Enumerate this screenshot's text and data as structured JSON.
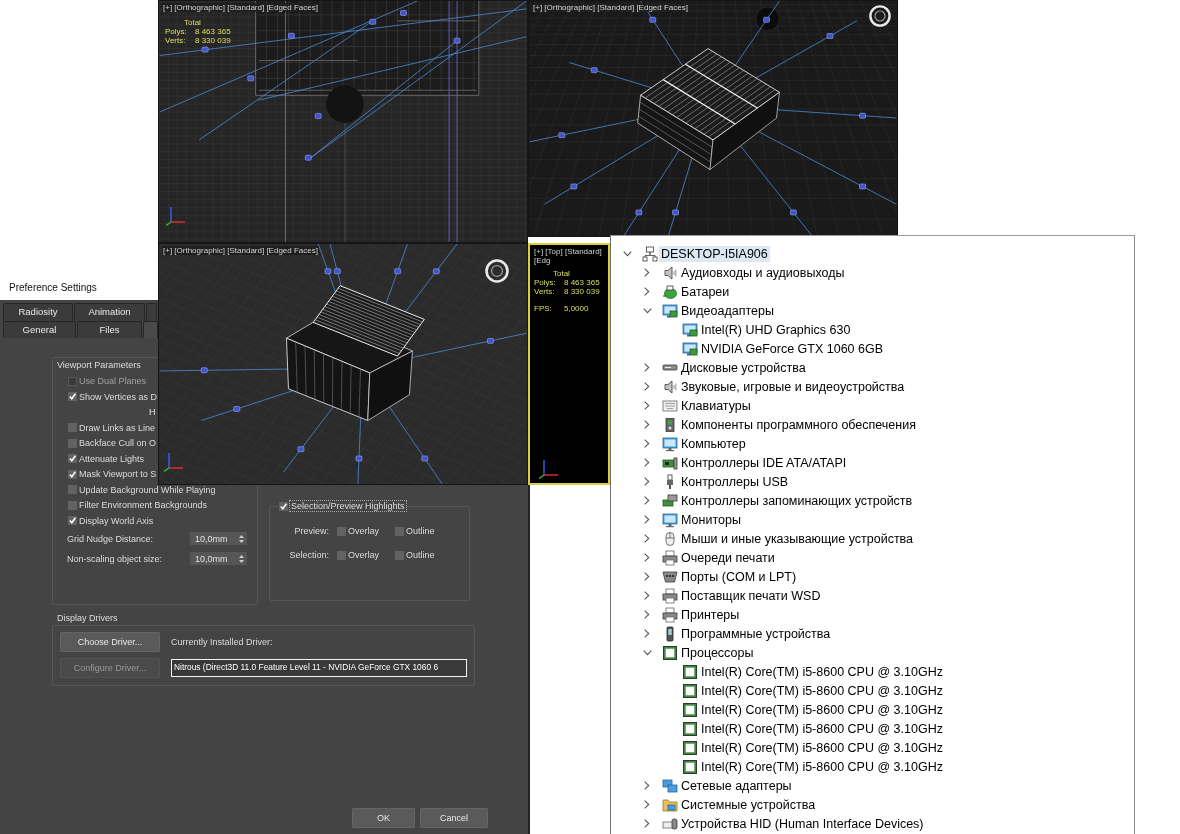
{
  "viewports": [
    {
      "kind": "interior",
      "label": "[+] [Orthographic] [Standard] [Edged Faces]",
      "active": false,
      "stats": {
        "heading": "Total",
        "rows": [
          {
            "name": "Polys:",
            "value": "8 463 365"
          },
          {
            "name": "Verts:",
            "value": "8 330 039"
          }
        ]
      }
    },
    {
      "kind": "perspective",
      "label": "[+] [Orthographic] [Standard] [Edged Faces]",
      "active": false
    },
    {
      "kind": "iso",
      "label": "[+] [Orthographic] [Standard] [Edged Faces]",
      "active": false
    },
    {
      "kind": "top",
      "label": "[+] [Top] [Standard] [Edg",
      "active": true,
      "stats": {
        "heading": "Total",
        "rows": [
          {
            "name": "Polys:",
            "value": "8 463 365"
          },
          {
            "name": "Verts:",
            "value": "8 330 039"
          }
        ],
        "fps": {
          "name": "FPS:",
          "value": "5,0000"
        }
      }
    }
  ],
  "preferences": {
    "title": "Preference Settings",
    "tab_rows": [
      [
        {
          "label": "Radiosity",
          "selected": false
        },
        {
          "label": "Animation",
          "selected": false
        },
        {
          "selected": false
        }
      ],
      [
        {
          "label": "General",
          "selected": false
        },
        {
          "label": "Files",
          "selected": false
        },
        {
          "selected": true
        }
      ]
    ],
    "viewport_parameters": {
      "title": "Viewport Parameters",
      "options": [
        {
          "kind": "check",
          "label": "Use Dual Planes",
          "checked": false,
          "disabled": true
        },
        {
          "kind": "check",
          "label": "Show Vertices as D",
          "checked": true,
          "disabled": false
        },
        {
          "kind": "text",
          "label": "H"
        },
        {
          "kind": "check",
          "label": "Draw Links as Line",
          "checked": false,
          "disabled": false
        },
        {
          "kind": "check",
          "label": "Backface Cull on O",
          "checked": false,
          "disabled": false
        },
        {
          "kind": "check",
          "label": "Attenuate Lights",
          "checked": true,
          "disabled": false
        },
        {
          "kind": "check",
          "label": "Mask Viewport to S",
          "checked": true,
          "disabled": false
        },
        {
          "kind": "check",
          "label": "Update Background While Playing",
          "checked": false,
          "disabled": false
        },
        {
          "kind": "check",
          "label": "Filter Environment Backgrounds",
          "checked": false,
          "disabled": false
        },
        {
          "kind": "check",
          "label": "Display World Axis",
          "checked": true,
          "disabled": false
        },
        {
          "kind": "spinner",
          "label": "Grid Nudge Distance:",
          "value": "10,0mm"
        },
        {
          "kind": "spinner",
          "label": "Non-scaling object size:",
          "value": "10,0mm"
        }
      ]
    },
    "highlights": {
      "label": "Selection/Preview Highlights",
      "checked": true,
      "rows": [
        {
          "label": "Preview:",
          "options": [
            {
              "label": "Overlay",
              "checked": false
            },
            {
              "label": "Outline",
              "checked": false
            }
          ]
        },
        {
          "label": "Selection:",
          "options": [
            {
              "label": "Overlay",
              "checked": false
            },
            {
              "label": "Outline",
              "checked": false
            }
          ]
        }
      ]
    },
    "display_drivers": {
      "title": "Display Drivers",
      "buttons": [
        {
          "label": "Choose Driver...",
          "disabled": false
        },
        {
          "label": "Configure Driver...",
          "disabled": true
        }
      ],
      "current_label": "Currently Installed Driver:",
      "current_value": "Nitrous (Direct3D 11.0 Feature Level 11 - NVIDIA GeForce GTX 1060 6"
    },
    "buttons": [
      "OK",
      "Cancel"
    ]
  },
  "device_manager": {
    "tree": [
      {
        "label": "DESKTOP-I5IA906",
        "kind": "network_computer",
        "expanded": true,
        "selected": true,
        "children": [
          {
            "label": "Аудиовходы и аудиовыходы",
            "kind": "audio",
            "expanded": false,
            "selected": false
          },
          {
            "label": "Батареи",
            "kind": "battery",
            "expanded": false,
            "selected": false
          },
          {
            "label": "Видеоадаптеры",
            "kind": "display",
            "expanded": true,
            "selected": false,
            "children": [
              {
                "label": "Intel(R) UHD Graphics 630",
                "kind": "display",
                "selected": false
              },
              {
                "label": "NVIDIA GeForce GTX 1060 6GB",
                "kind": "display",
                "selected": false
              }
            ]
          },
          {
            "label": "Дисковые устройства",
            "kind": "disk",
            "expanded": false,
            "selected": false
          },
          {
            "label": "Звуковые, игровые и видеоустройства",
            "kind": "sound",
            "expanded": false,
            "selected": false
          },
          {
            "label": "Клавиатуры",
            "kind": "keyboard",
            "expanded": false,
            "selected": false
          },
          {
            "label": "Компоненты программного обеспечения",
            "kind": "component",
            "expanded": false,
            "selected": false
          },
          {
            "label": "Компьютер",
            "kind": "computer",
            "expanded": false,
            "selected": false
          },
          {
            "label": "Контроллеры IDE ATA/ATAPI",
            "kind": "ide",
            "expanded": false,
            "selected": false
          },
          {
            "label": "Контроллеры USB",
            "kind": "usb",
            "expanded": false,
            "selected": false
          },
          {
            "label": "Контроллеры запоминающих устройств",
            "kind": "storage",
            "expanded": false,
            "selected": false
          },
          {
            "label": "Мониторы",
            "kind": "monitor",
            "expanded": false,
            "selected": false
          },
          {
            "label": "Мыши и иные указывающие устройства",
            "kind": "mouse",
            "expanded": false,
            "selected": false
          },
          {
            "label": "Очереди печати",
            "kind": "print_queue",
            "expanded": false,
            "selected": false
          },
          {
            "label": "Порты (COM и LPT)",
            "kind": "port",
            "expanded": false,
            "selected": false
          },
          {
            "label": "Поставщик печати WSD",
            "kind": "wsd",
            "expanded": false,
            "selected": false
          },
          {
            "label": "Принтеры",
            "kind": "printer",
            "expanded": false,
            "selected": false
          },
          {
            "label": "Программные устройства",
            "kind": "software_device",
            "expanded": false,
            "selected": false
          },
          {
            "label": "Процессоры",
            "kind": "processor",
            "expanded": true,
            "selected": false,
            "children": [
              {
                "label": "Intel(R) Core(TM) i5-8600 CPU @ 3.10GHz",
                "kind": "processor",
                "selected": false
              },
              {
                "label": "Intel(R) Core(TM) i5-8600 CPU @ 3.10GHz",
                "kind": "processor",
                "selected": false
              },
              {
                "label": "Intel(R) Core(TM) i5-8600 CPU @ 3.10GHz",
                "kind": "processor",
                "selected": false
              },
              {
                "label": "Intel(R) Core(TM) i5-8600 CPU @ 3.10GHz",
                "kind": "processor",
                "selected": false
              },
              {
                "label": "Intel(R) Core(TM) i5-8600 CPU @ 3.10GHz",
                "kind": "processor",
                "selected": false
              },
              {
                "label": "Intel(R) Core(TM) i5-8600 CPU @ 3.10GHz",
                "kind": "processor",
                "selected": false
              }
            ]
          },
          {
            "label": "Сетевые адаптеры",
            "kind": "network",
            "expanded": false,
            "selected": false
          },
          {
            "label": "Системные устройства",
            "kind": "system",
            "expanded": false,
            "selected": false
          },
          {
            "label": "Устройства HID (Human Interface Devices)",
            "kind": "hid",
            "expanded": false,
            "selected": false
          }
        ]
      }
    ]
  }
}
